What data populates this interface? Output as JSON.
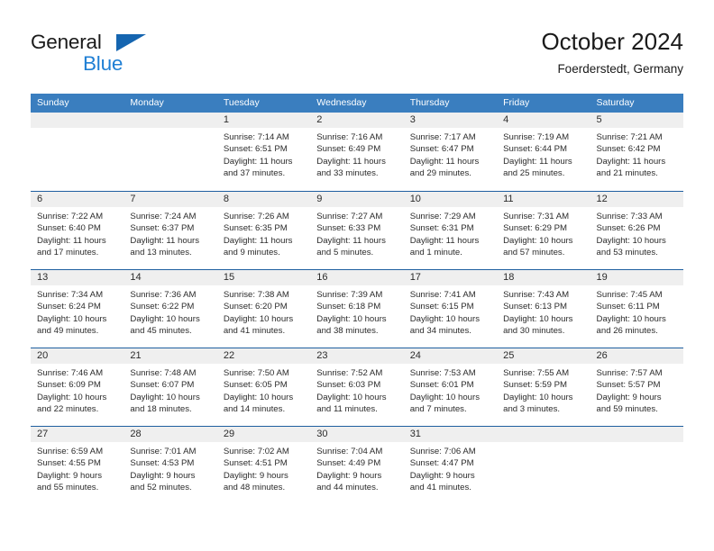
{
  "brand": {
    "name_part1": "General",
    "name_part2": "Blue",
    "triangle_icon": "triangle-icon",
    "accent_dark": "#1565b0",
    "accent_light": "#1f7fd4"
  },
  "header": {
    "title": "October 2024",
    "subtitle": "Foerderstedt, Germany"
  },
  "calendar": {
    "header_bg": "#3a7ebf",
    "row_divider": "#1f5fa0",
    "daynum_bg": "#efefef",
    "weekdays": [
      "Sunday",
      "Monday",
      "Tuesday",
      "Wednesday",
      "Thursday",
      "Friday",
      "Saturday"
    ],
    "labels": {
      "sunrise": "Sunrise:",
      "sunset": "Sunset:",
      "daylight": "Daylight:"
    },
    "weeks": [
      [
        {
          "day": ""
        },
        {
          "day": ""
        },
        {
          "day": "1",
          "sunrise": "Sunrise: 7:14 AM",
          "sunset": "Sunset: 6:51 PM",
          "daylight_l1": "Daylight: 11 hours",
          "daylight_l2": "and 37 minutes."
        },
        {
          "day": "2",
          "sunrise": "Sunrise: 7:16 AM",
          "sunset": "Sunset: 6:49 PM",
          "daylight_l1": "Daylight: 11 hours",
          "daylight_l2": "and 33 minutes."
        },
        {
          "day": "3",
          "sunrise": "Sunrise: 7:17 AM",
          "sunset": "Sunset: 6:47 PM",
          "daylight_l1": "Daylight: 11 hours",
          "daylight_l2": "and 29 minutes."
        },
        {
          "day": "4",
          "sunrise": "Sunrise: 7:19 AM",
          "sunset": "Sunset: 6:44 PM",
          "daylight_l1": "Daylight: 11 hours",
          "daylight_l2": "and 25 minutes."
        },
        {
          "day": "5",
          "sunrise": "Sunrise: 7:21 AM",
          "sunset": "Sunset: 6:42 PM",
          "daylight_l1": "Daylight: 11 hours",
          "daylight_l2": "and 21 minutes."
        }
      ],
      [
        {
          "day": "6",
          "sunrise": "Sunrise: 7:22 AM",
          "sunset": "Sunset: 6:40 PM",
          "daylight_l1": "Daylight: 11 hours",
          "daylight_l2": "and 17 minutes."
        },
        {
          "day": "7",
          "sunrise": "Sunrise: 7:24 AM",
          "sunset": "Sunset: 6:37 PM",
          "daylight_l1": "Daylight: 11 hours",
          "daylight_l2": "and 13 minutes."
        },
        {
          "day": "8",
          "sunrise": "Sunrise: 7:26 AM",
          "sunset": "Sunset: 6:35 PM",
          "daylight_l1": "Daylight: 11 hours",
          "daylight_l2": "and 9 minutes."
        },
        {
          "day": "9",
          "sunrise": "Sunrise: 7:27 AM",
          "sunset": "Sunset: 6:33 PM",
          "daylight_l1": "Daylight: 11 hours",
          "daylight_l2": "and 5 minutes."
        },
        {
          "day": "10",
          "sunrise": "Sunrise: 7:29 AM",
          "sunset": "Sunset: 6:31 PM",
          "daylight_l1": "Daylight: 11 hours",
          "daylight_l2": "and 1 minute."
        },
        {
          "day": "11",
          "sunrise": "Sunrise: 7:31 AM",
          "sunset": "Sunset: 6:29 PM",
          "daylight_l1": "Daylight: 10 hours",
          "daylight_l2": "and 57 minutes."
        },
        {
          "day": "12",
          "sunrise": "Sunrise: 7:33 AM",
          "sunset": "Sunset: 6:26 PM",
          "daylight_l1": "Daylight: 10 hours",
          "daylight_l2": "and 53 minutes."
        }
      ],
      [
        {
          "day": "13",
          "sunrise": "Sunrise: 7:34 AM",
          "sunset": "Sunset: 6:24 PM",
          "daylight_l1": "Daylight: 10 hours",
          "daylight_l2": "and 49 minutes."
        },
        {
          "day": "14",
          "sunrise": "Sunrise: 7:36 AM",
          "sunset": "Sunset: 6:22 PM",
          "daylight_l1": "Daylight: 10 hours",
          "daylight_l2": "and 45 minutes."
        },
        {
          "day": "15",
          "sunrise": "Sunrise: 7:38 AM",
          "sunset": "Sunset: 6:20 PM",
          "daylight_l1": "Daylight: 10 hours",
          "daylight_l2": "and 41 minutes."
        },
        {
          "day": "16",
          "sunrise": "Sunrise: 7:39 AM",
          "sunset": "Sunset: 6:18 PM",
          "daylight_l1": "Daylight: 10 hours",
          "daylight_l2": "and 38 minutes."
        },
        {
          "day": "17",
          "sunrise": "Sunrise: 7:41 AM",
          "sunset": "Sunset: 6:15 PM",
          "daylight_l1": "Daylight: 10 hours",
          "daylight_l2": "and 34 minutes."
        },
        {
          "day": "18",
          "sunrise": "Sunrise: 7:43 AM",
          "sunset": "Sunset: 6:13 PM",
          "daylight_l1": "Daylight: 10 hours",
          "daylight_l2": "and 30 minutes."
        },
        {
          "day": "19",
          "sunrise": "Sunrise: 7:45 AM",
          "sunset": "Sunset: 6:11 PM",
          "daylight_l1": "Daylight: 10 hours",
          "daylight_l2": "and 26 minutes."
        }
      ],
      [
        {
          "day": "20",
          "sunrise": "Sunrise: 7:46 AM",
          "sunset": "Sunset: 6:09 PM",
          "daylight_l1": "Daylight: 10 hours",
          "daylight_l2": "and 22 minutes."
        },
        {
          "day": "21",
          "sunrise": "Sunrise: 7:48 AM",
          "sunset": "Sunset: 6:07 PM",
          "daylight_l1": "Daylight: 10 hours",
          "daylight_l2": "and 18 minutes."
        },
        {
          "day": "22",
          "sunrise": "Sunrise: 7:50 AM",
          "sunset": "Sunset: 6:05 PM",
          "daylight_l1": "Daylight: 10 hours",
          "daylight_l2": "and 14 minutes."
        },
        {
          "day": "23",
          "sunrise": "Sunrise: 7:52 AM",
          "sunset": "Sunset: 6:03 PM",
          "daylight_l1": "Daylight: 10 hours",
          "daylight_l2": "and 11 minutes."
        },
        {
          "day": "24",
          "sunrise": "Sunrise: 7:53 AM",
          "sunset": "Sunset: 6:01 PM",
          "daylight_l1": "Daylight: 10 hours",
          "daylight_l2": "and 7 minutes."
        },
        {
          "day": "25",
          "sunrise": "Sunrise: 7:55 AM",
          "sunset": "Sunset: 5:59 PM",
          "daylight_l1": "Daylight: 10 hours",
          "daylight_l2": "and 3 minutes."
        },
        {
          "day": "26",
          "sunrise": "Sunrise: 7:57 AM",
          "sunset": "Sunset: 5:57 PM",
          "daylight_l1": "Daylight: 9 hours",
          "daylight_l2": "and 59 minutes."
        }
      ],
      [
        {
          "day": "27",
          "sunrise": "Sunrise: 6:59 AM",
          "sunset": "Sunset: 4:55 PM",
          "daylight_l1": "Daylight: 9 hours",
          "daylight_l2": "and 55 minutes."
        },
        {
          "day": "28",
          "sunrise": "Sunrise: 7:01 AM",
          "sunset": "Sunset: 4:53 PM",
          "daylight_l1": "Daylight: 9 hours",
          "daylight_l2": "and 52 minutes."
        },
        {
          "day": "29",
          "sunrise": "Sunrise: 7:02 AM",
          "sunset": "Sunset: 4:51 PM",
          "daylight_l1": "Daylight: 9 hours",
          "daylight_l2": "and 48 minutes."
        },
        {
          "day": "30",
          "sunrise": "Sunrise: 7:04 AM",
          "sunset": "Sunset: 4:49 PM",
          "daylight_l1": "Daylight: 9 hours",
          "daylight_l2": "and 44 minutes."
        },
        {
          "day": "31",
          "sunrise": "Sunrise: 7:06 AM",
          "sunset": "Sunset: 4:47 PM",
          "daylight_l1": "Daylight: 9 hours",
          "daylight_l2": "and 41 minutes."
        },
        {
          "day": ""
        },
        {
          "day": ""
        }
      ]
    ]
  }
}
